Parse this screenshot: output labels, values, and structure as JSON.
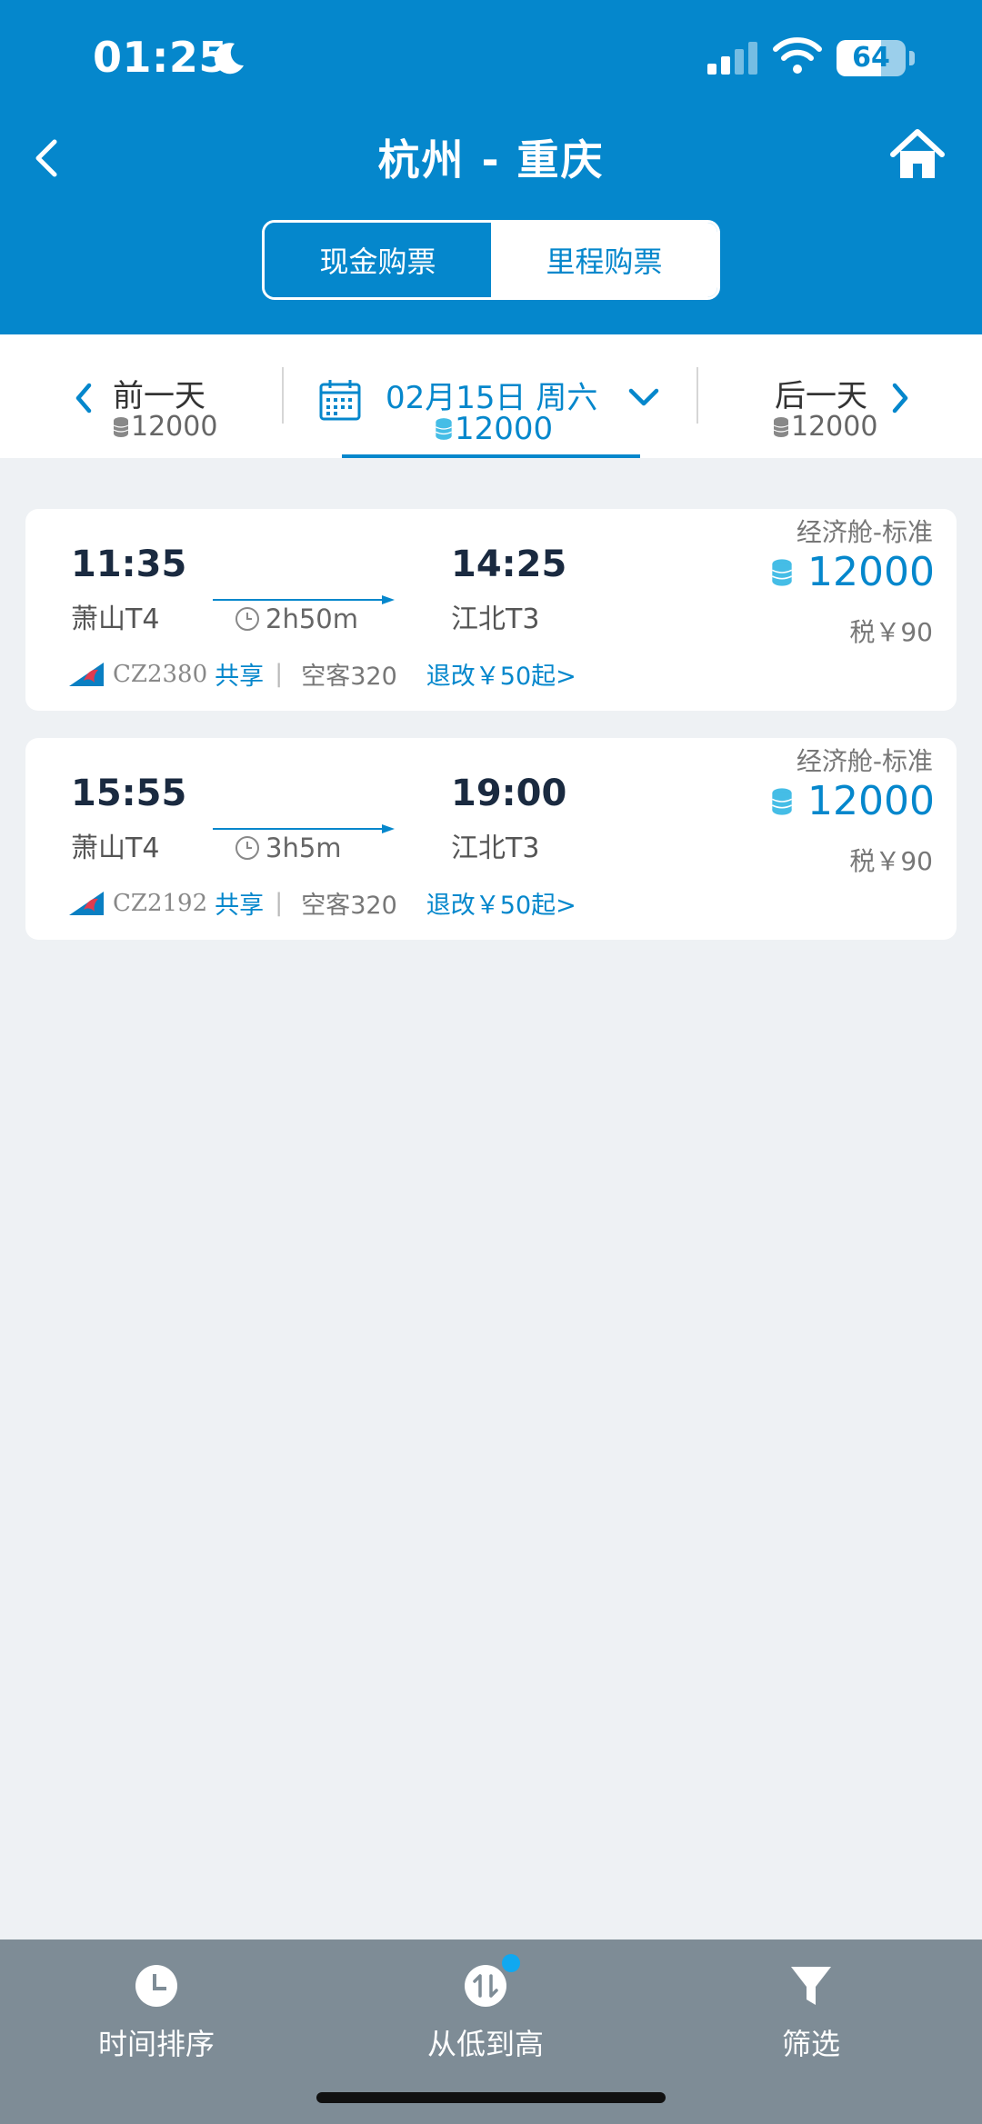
{
  "status": {
    "time": "01:25",
    "battery": "64",
    "battery_level": 0.64
  },
  "header": {
    "title": "杭州 - 重庆"
  },
  "segment": {
    "cash_label": "现金购票",
    "miles_label": "里程购票",
    "selected": "miles"
  },
  "date_bar": {
    "prev": {
      "label": "前一天",
      "miles": "12000"
    },
    "current": {
      "date": "02月15日 周六",
      "miles": "12000"
    },
    "next": {
      "label": "后一天",
      "miles": "12000"
    }
  },
  "flights": [
    {
      "dep_time": "11:35",
      "dep_airport": "萧山T4",
      "arr_time": "14:25",
      "arr_airport": "江北T3",
      "duration": "2h50m",
      "cabin": "经济舱-标准",
      "miles": "12000",
      "tax": "税￥90",
      "flight_no": "CZ2380",
      "share": "共享",
      "plane": "空客320",
      "refund": "退改￥50起>"
    },
    {
      "dep_time": "15:55",
      "dep_airport": "萧山T4",
      "arr_time": "19:00",
      "arr_airport": "江北T3",
      "duration": "3h5m",
      "cabin": "经济舱-标准",
      "miles": "12000",
      "tax": "税￥90",
      "flight_no": "CZ2192",
      "share": "共享",
      "plane": "空客320",
      "refund": "退改￥50起>"
    }
  ],
  "bottom_tabs": [
    {
      "label": "时间排序",
      "icon": "clock-icon"
    },
    {
      "label": "从低到高",
      "icon": "sort-icon"
    },
    {
      "label": "筛选",
      "icon": "filter-icon"
    }
  ],
  "colors": {
    "brand": "#0587cc",
    "background": "#eef1f4",
    "bottom_bar": "#7e8c96",
    "badge": "#10a8f0"
  }
}
